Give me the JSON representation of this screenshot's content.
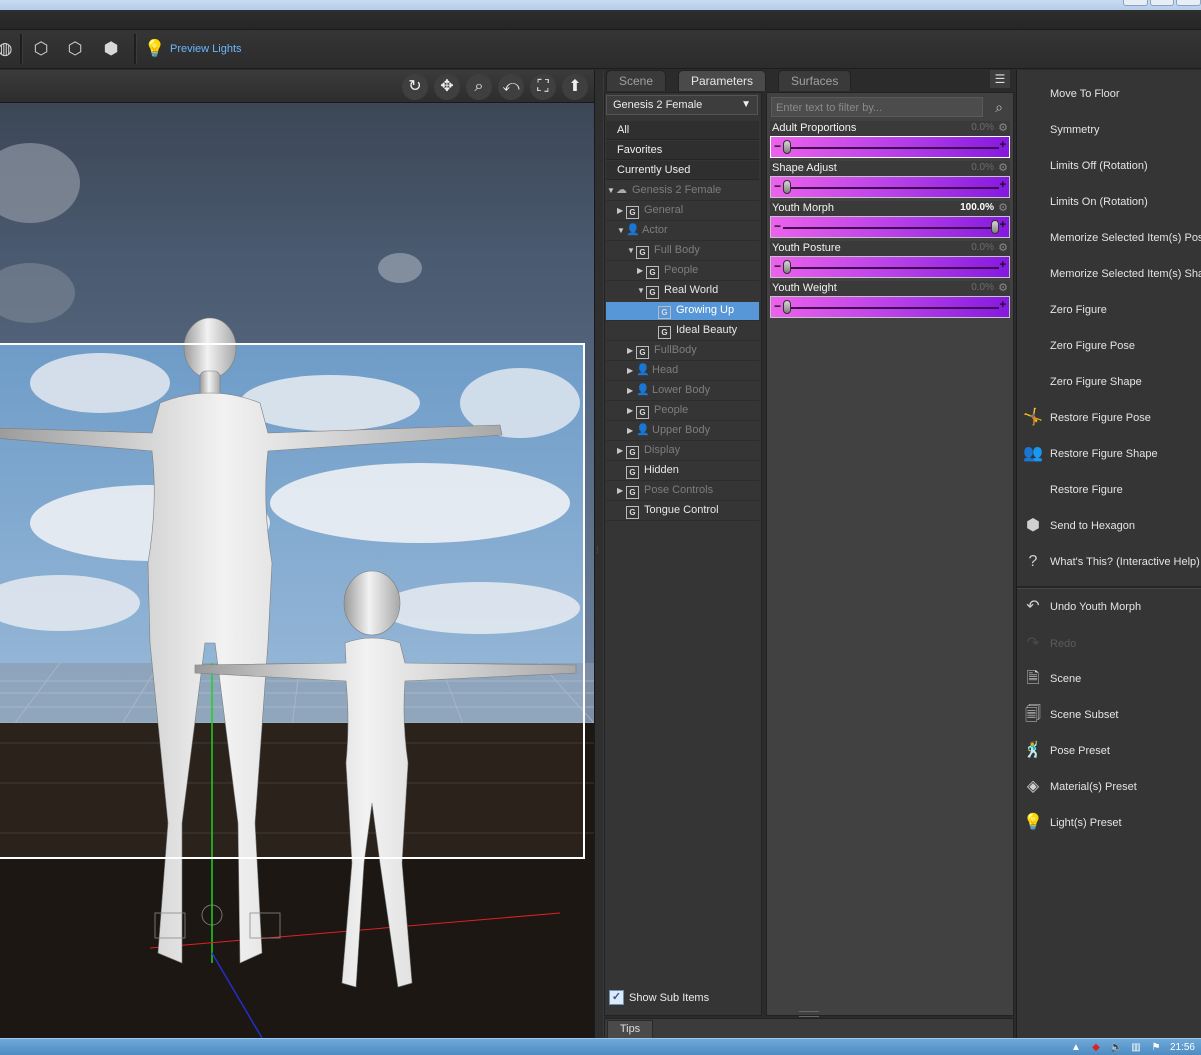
{
  "toolbar": {
    "preview_lights": "Preview Lights",
    "icons": [
      "globe-icon",
      "new-primitive-icon",
      "new-group-icon",
      "new-node-icon"
    ]
  },
  "viewport": {
    "controls": [
      "orbit-icon",
      "pan-icon",
      "zoom-icon",
      "roll-icon",
      "frame-icon",
      "camera-up-icon"
    ]
  },
  "tabs": {
    "scene": "Scene",
    "parameters": "Parameters",
    "surfaces": "Surfaces"
  },
  "tree": {
    "figure": "Genesis 2 Female",
    "categories": [
      "All",
      "Favorites",
      "Currently Used"
    ],
    "root": "Genesis 2 Female",
    "nodes": {
      "general": "General",
      "actor": "Actor",
      "full_body": "Full Body",
      "people": "People",
      "real_world": "Real World",
      "growing_up": "Growing Up",
      "ideal_beauty": "Ideal Beauty",
      "fullbody": "FullBody",
      "head": "Head",
      "lower_body": "Lower Body",
      "people2": "People",
      "upper_body": "Upper Body",
      "display": "Display",
      "hidden": "Hidden",
      "pose_controls": "Pose Controls",
      "tongue_control": "Tongue Control"
    },
    "show_sub_items": "Show Sub Items",
    "show_sub_items_checked": true
  },
  "sliders": {
    "filter_placeholder": "Enter text to filter by...",
    "items": [
      {
        "label": "Adult Proportions",
        "value": "0.0%",
        "fraction": 0.0
      },
      {
        "label": "Shape Adjust",
        "value": "0.0%",
        "fraction": 0.0
      },
      {
        "label": "Youth Morph",
        "value": "100.0%",
        "fraction": 1.0
      },
      {
        "label": "Youth Posture",
        "value": "0.0%",
        "fraction": 0.0
      },
      {
        "label": "Youth Weight",
        "value": "0.0%",
        "fraction": 0.0
      }
    ]
  },
  "tips": "Tips",
  "actions": {
    "move_to_floor": "Move To Floor",
    "symmetry": "Symmetry",
    "limits_off": "Limits Off (Rotation)",
    "limits_on": "Limits On (Rotation)",
    "memorize_pose": "Memorize Selected Item(s) Pose",
    "memorize_shape": "Memorize Selected Item(s) Shape",
    "zero_figure": "Zero Figure",
    "zero_figure_pose": "Zero Figure Pose",
    "zero_figure_shape": "Zero Figure Shape",
    "restore_pose": "Restore Figure Pose",
    "restore_shape": "Restore Figure Shape",
    "restore_figure": "Restore Figure",
    "send_hexagon": "Send to Hexagon",
    "whats_this": "What's This? (Interactive Help)",
    "undo": "Undo Youth Morph",
    "redo": "Redo",
    "scene": "Scene",
    "scene_subset": "Scene Subset",
    "pose_preset": "Pose Preset",
    "material_preset": "Material(s) Preset",
    "light_preset": "Light(s) Preset"
  },
  "colors": {
    "slider_start": "#ec62ec",
    "slider_end": "#8518e0",
    "selection": "#5797d8",
    "accent_text": "#6cb6ff"
  },
  "taskbar": {
    "clock": "21:56"
  }
}
